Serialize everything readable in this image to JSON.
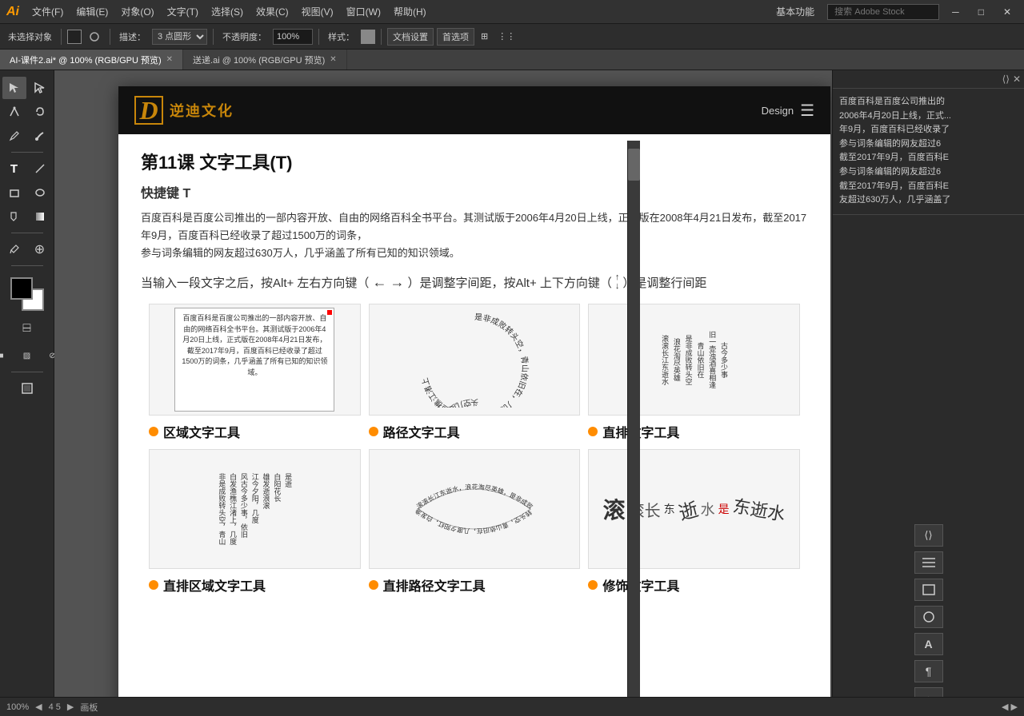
{
  "app": {
    "logo": "Ai",
    "title": "Adobe Illustrator"
  },
  "menubar": {
    "items": [
      "文件(F)",
      "编辑(E)",
      "对象(O)",
      "文字(T)",
      "选择(S)",
      "效果(C)",
      "视图(V)",
      "窗口(W)",
      "帮助(H)"
    ],
    "right": [
      "基本功能",
      "搜索 Adobe Stock"
    ]
  },
  "toolbar": {
    "no_selection": "未选择对象",
    "stroke": "描述：",
    "points": "3 点圆形",
    "opacity": "不透明度：",
    "opacity_val": "100%",
    "style": "样式：",
    "doc_settings": "文档设置",
    "preferences": "首选项"
  },
  "tabs": [
    {
      "label": "AI-课件2.ai* @ 100% (RGB/GPU 预览)",
      "active": true
    },
    {
      "label": "送递.ai @ 100% (RGB/GPU 预览)",
      "active": false
    }
  ],
  "lesson": {
    "title": "第11课   文字工具(T)",
    "shortcut": "快捷键 T",
    "intro_text": "百度百科是百度公司推出的一部内容开放、自由的网络百科全书平台。其测试版于2006年4月20日上线，正式版在2008年4月21日发布，截至2017年9月，百度百科已经收录了超过1500万的词条，\n参与词条编辑的网友超过630万人，几乎涵盖了所有已知的知识领域。",
    "direction_text": "当输入一段文字之后，按Alt+ 左右方向键（← →）是调整字间距，按Alt+ 上下方向键（  ）是调整行间距",
    "tools": [
      {
        "name": "区域文字工具",
        "dot_color": "#FF8C00"
      },
      {
        "name": "路径文字工具",
        "dot_color": "#FF8C00"
      },
      {
        "name": "直排文字工具",
        "dot_color": "#FF8C00"
      }
    ],
    "tools_bottom": [
      {
        "name": "直排区域文字工具",
        "dot_color": "#FF8C00"
      },
      {
        "name": "直排路径文字工具",
        "dot_color": "#FF8C00"
      },
      {
        "name": "修饰文字工具",
        "dot_color": "#FF8C00"
      }
    ]
  },
  "right_panel": {
    "text": "百度百科是百度公司推出的\n2006年4月20日上线，正式...\n年9月，百度百科已经收录了\n参与词条编辑的网友超过6\n截至2017年9月，百度百科E\n参与词条编辑的网友超过6\n截至2017年9月，百度百科E\n友超过630万人，几乎涵盖了"
  },
  "status": {
    "zoom": "100%",
    "pages": "4 5",
    "label": "画板"
  },
  "header": {
    "logo_symbol": "D",
    "logo_name": "逆迪文化",
    "nav": "Design"
  }
}
